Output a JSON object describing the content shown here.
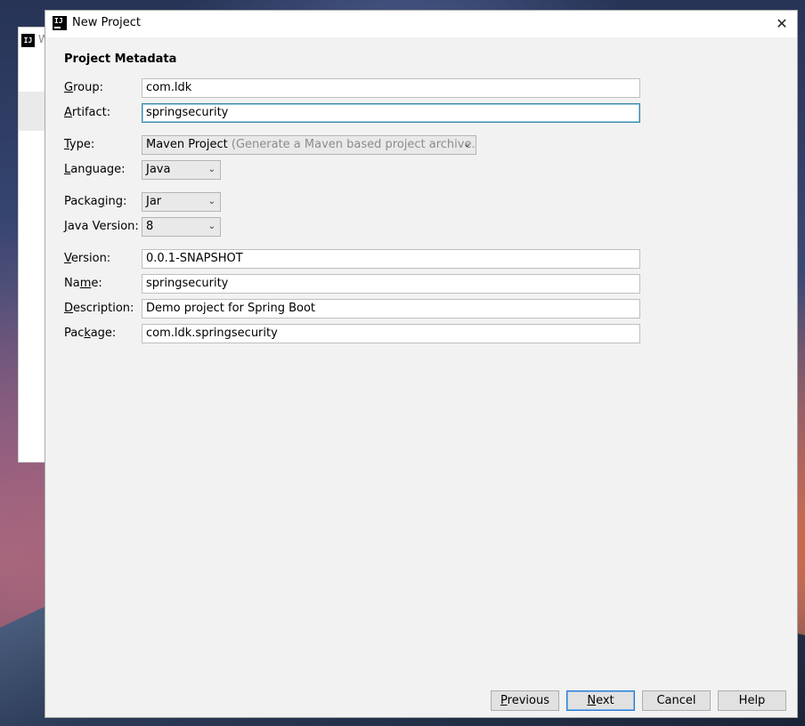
{
  "background_window": {
    "title_initial": "W"
  },
  "dialog": {
    "title": "New Project",
    "close_glyph": "✕"
  },
  "section": {
    "title": "Project Metadata"
  },
  "fields": {
    "group": {
      "mn": "G",
      "rest": "roup:",
      "value": "com.ldk"
    },
    "artifact": {
      "mn": "A",
      "rest": "rtifact:",
      "value": "springsecurity"
    },
    "type": {
      "mn": "T",
      "rest": "ype:",
      "value": "Maven Project",
      "hint": "(Generate a Maven based project archive.)"
    },
    "language": {
      "mn": "L",
      "rest": "anguage:",
      "value": "Java"
    },
    "packaging": {
      "pre": "Packa",
      "mn": "g",
      "rest": "ing:",
      "value": "Jar"
    },
    "java_version": {
      "mn": "J",
      "rest": "ava Version:",
      "value": "8"
    },
    "version": {
      "mn": "V",
      "rest": "ersion:",
      "value": "0.0.1-SNAPSHOT"
    },
    "name": {
      "pre": "Na",
      "mn": "m",
      "rest": "e:",
      "value": "springsecurity"
    },
    "description": {
      "mn": "D",
      "rest": "escription:",
      "value": "Demo project for Spring Boot"
    },
    "package": {
      "pre": "Pac",
      "mn": "k",
      "rest": "age:",
      "value": "com.ldk.springsecurity"
    }
  },
  "buttons": {
    "previous": {
      "mn": "P",
      "rest": "revious"
    },
    "next": {
      "mn": "N",
      "rest": "ext"
    },
    "cancel": "Cancel",
    "help": "Help"
  },
  "icons": {
    "app": "intellij-logo-icon",
    "dropdown": "chevron-down-icon",
    "close": "close-icon"
  },
  "colors": {
    "focus_border": "#3b87a8",
    "default_button_border": "#2a7ad0"
  }
}
